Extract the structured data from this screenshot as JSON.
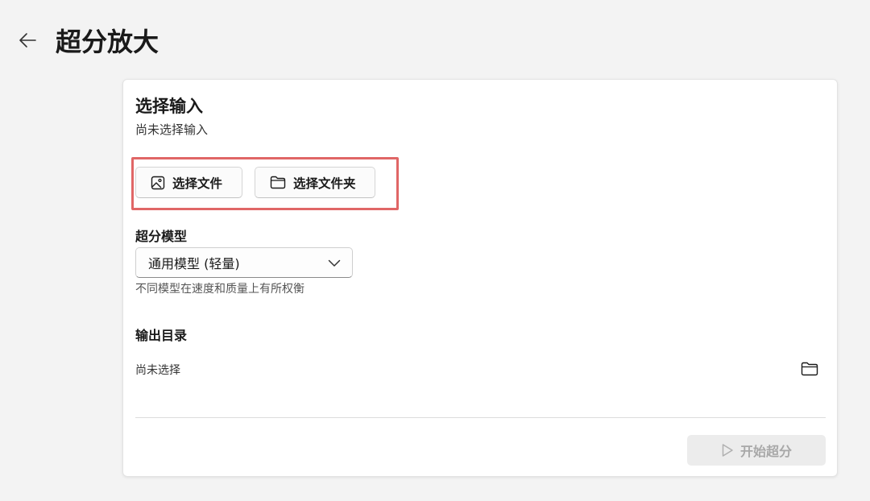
{
  "header": {
    "title": "超分放大",
    "back_icon": "arrow-left-icon"
  },
  "input_section": {
    "title": "选择输入",
    "status": "尚未选择输入",
    "select_file_label": "选择文件",
    "select_file_icon": "image-icon",
    "select_folder_label": "选择文件夹",
    "select_folder_icon": "folder-icon",
    "highlight_color": "#e06666"
  },
  "model_section": {
    "label": "超分模型",
    "selected_model": "通用模型 (轻量)",
    "hint": "不同模型在速度和质量上有所权衡"
  },
  "output_section": {
    "label": "输出目录",
    "value": "尚未选择",
    "browse_icon": "folder-icon"
  },
  "actions": {
    "start_label": "开始超分",
    "start_icon": "play-icon",
    "start_enabled": false
  }
}
